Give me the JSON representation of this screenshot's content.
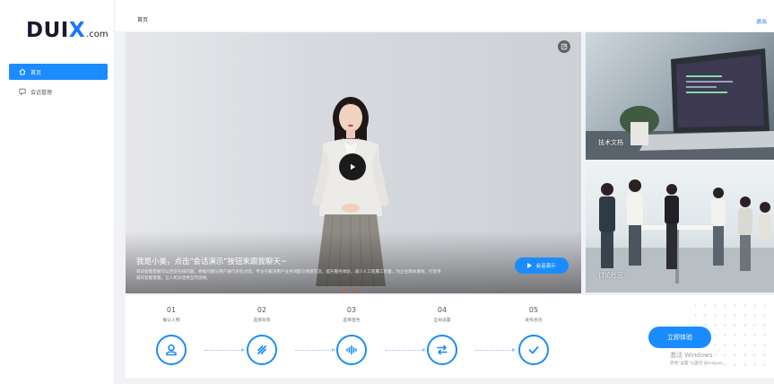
{
  "logo": {
    "main_prefix": "DUI",
    "main_x": "X",
    "suffix": ".com"
  },
  "sidebar": {
    "items": [
      {
        "label": "首页",
        "icon": "home-icon",
        "active": true
      },
      {
        "label": "会话管理",
        "icon": "chat-icon",
        "active": false
      }
    ]
  },
  "header": {
    "breadcrumb": "首页",
    "logout": "退出"
  },
  "hero": {
    "title": "我是小美，点击\"会话演示\"按钮来跟我聊天~",
    "description": "目前智能客服可以回答在线问题，根据问题与用户进行多轮对话，专注于解决用户业务问题与情感交流，提升服务体验，减少人工客服工作量，为企业降本增效，打造专属的智能客服，让人机对话更自然流畅。",
    "demo_button": "会话演示"
  },
  "cards": [
    {
      "label": "技术文档",
      "icon": "docs-icon"
    },
    {
      "label": "讨论社区",
      "icon": "forum-icon"
    }
  ],
  "steps": [
    {
      "num": "01",
      "label": "确认人物",
      "icon": "person-icon"
    },
    {
      "num": "02",
      "label": "选择背景",
      "icon": "background-icon"
    },
    {
      "num": "03",
      "label": "选择音色",
      "icon": "voice-icon"
    },
    {
      "num": "04",
      "label": "全局设置",
      "icon": "settings-icon"
    },
    {
      "num": "05",
      "label": "发布会话",
      "icon": "publish-icon"
    }
  ],
  "try_button": "立即体验",
  "watermark": {
    "line1": "激活 Windows",
    "line2": "转到\"设置\"以激活 Windows。"
  },
  "colors": {
    "accent": "#1a8cff",
    "sidebar_bg": "#ffffff",
    "page_bg": "#f0f2f5"
  }
}
